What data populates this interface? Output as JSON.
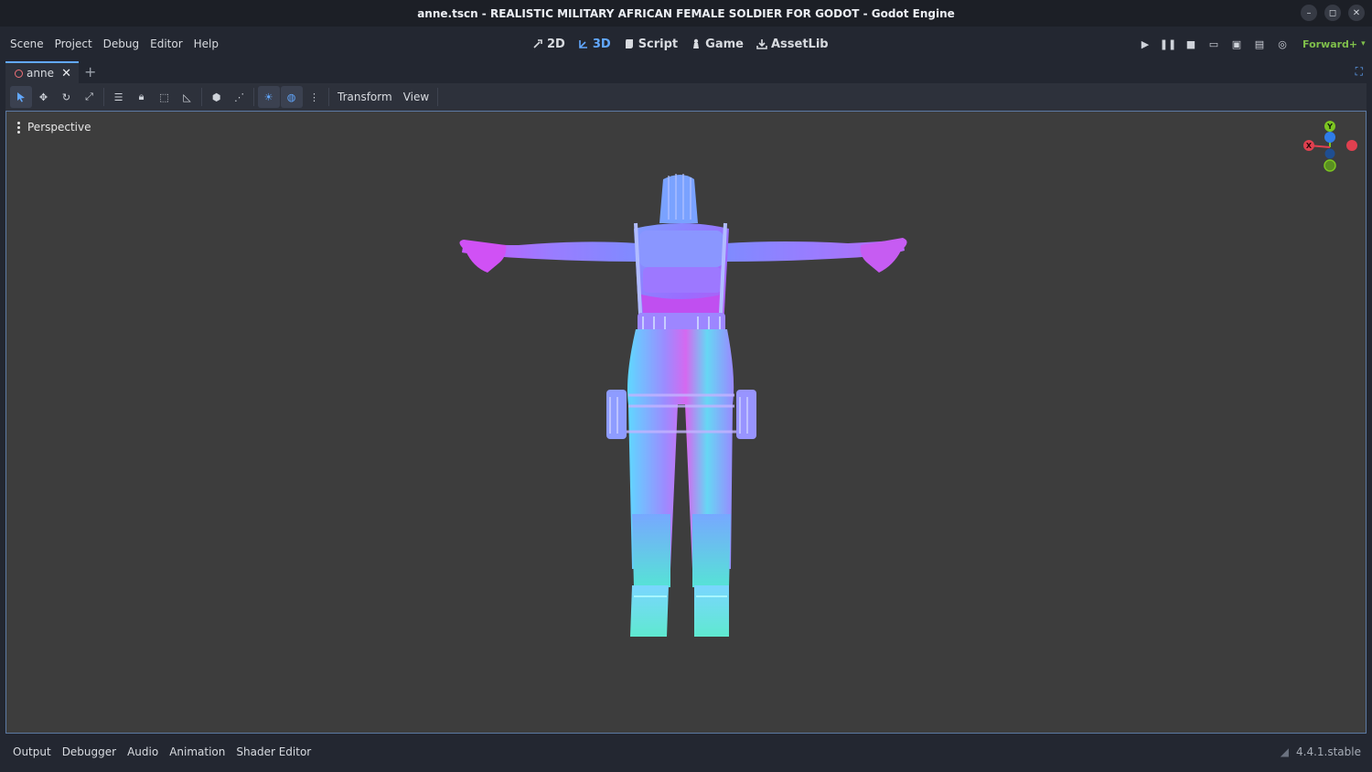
{
  "window": {
    "title": "anne.tscn - REALISTIC MILITARY AFRICAN FEMALE SOLDIER FOR GODOT - Godot Engine"
  },
  "menus": [
    "Scene",
    "Project",
    "Debug",
    "Editor",
    "Help"
  ],
  "workspaces": {
    "w2d": "2D",
    "w3d": "3D",
    "script": "Script",
    "game": "Game",
    "assetlib": "AssetLib",
    "active": "3D"
  },
  "renderer": "Forward+",
  "scene_tab": {
    "label": "anne"
  },
  "toolbar": {
    "transform": "Transform",
    "view": "View"
  },
  "viewport": {
    "label": "Perspective"
  },
  "gizmo": {
    "y": "Y",
    "x": "X"
  },
  "bottom_panel": [
    "Output",
    "Debugger",
    "Audio",
    "Animation",
    "Shader Editor"
  ],
  "version": "4.4.1.stable",
  "colors": {
    "accent": "#62a8ff",
    "renderer": "#7fbf4b",
    "x_axis": "#e0404f",
    "y_axis": "#7cc521",
    "z_axis": "#2f7ce8"
  }
}
